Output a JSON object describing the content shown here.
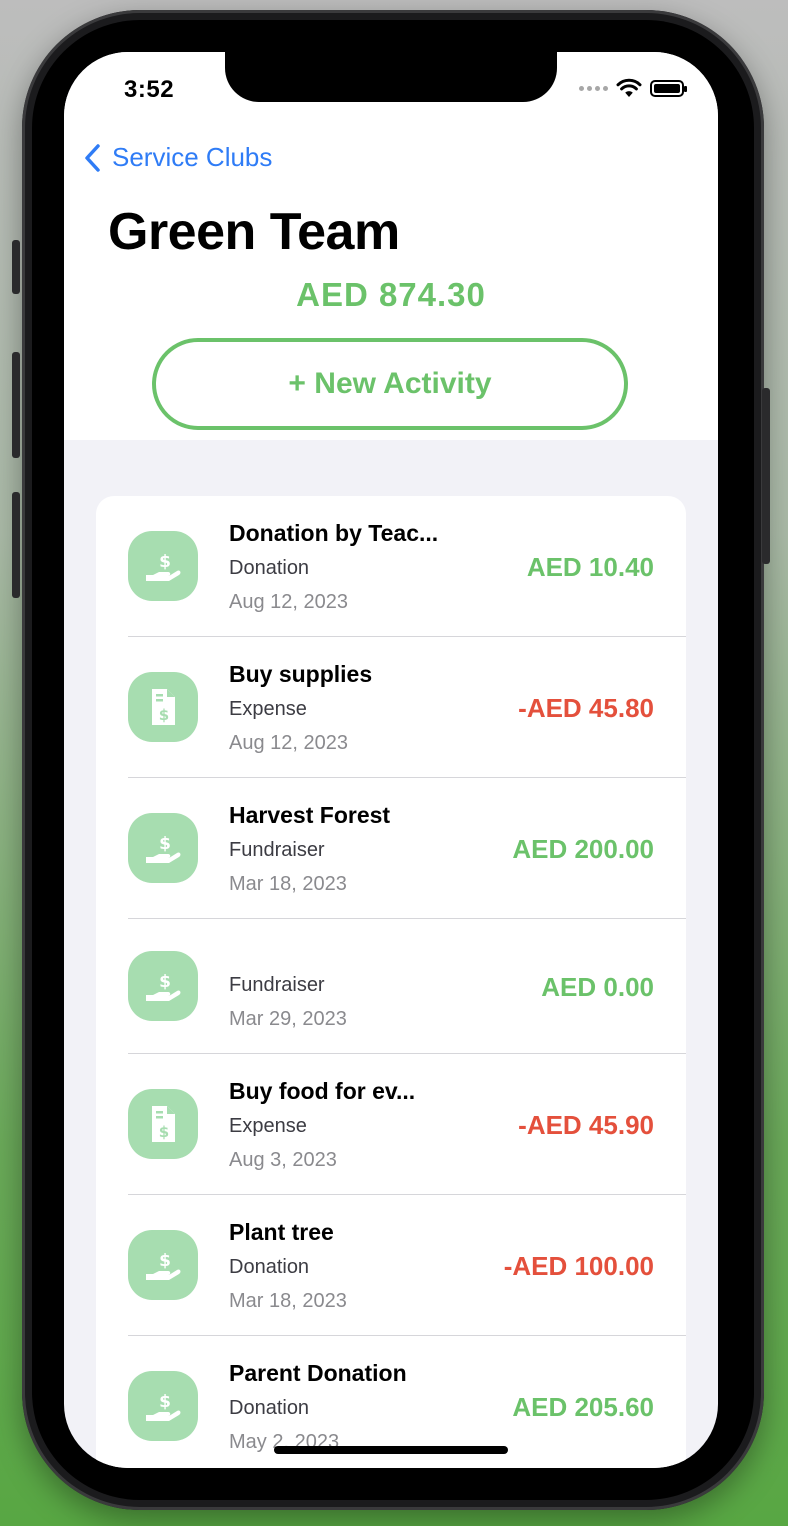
{
  "status_bar": {
    "time": "3:52"
  },
  "nav": {
    "back_label": "Service Clubs"
  },
  "header": {
    "title": "Green Team",
    "balance": "AED 874.30",
    "new_activity_label": "+ New Activity"
  },
  "colors": {
    "positive": "#6bc26a",
    "negative": "#e4503c",
    "icon_bg": "#a7ddb0",
    "link": "#2f7cf6"
  },
  "activities": [
    {
      "name": "Donation by Teac...",
      "type": "Donation",
      "date": "Aug 12, 2023",
      "amount": "AED 10.40",
      "icon": "hand-dollar-icon"
    },
    {
      "name": "Buy supplies",
      "type": "Expense",
      "date": "Aug 12, 2023",
      "amount": "-AED 45.80",
      "icon": "receipt-dollar-icon"
    },
    {
      "name": "Harvest Forest",
      "type": "Fundraiser",
      "date": "Mar 18, 2023",
      "amount": "AED 200.00",
      "icon": "hand-dollar-icon"
    },
    {
      "name": "",
      "type": "Fundraiser",
      "date": "Mar 29, 2023",
      "amount": "AED 0.00",
      "icon": "hand-dollar-icon"
    },
    {
      "name": "Buy food for ev...",
      "type": "Expense",
      "date": "Aug 3, 2023",
      "amount": "-AED 45.90",
      "icon": "receipt-dollar-icon"
    },
    {
      "name": "Plant tree",
      "type": "Donation",
      "date": "Mar 18, 2023",
      "amount": "-AED 100.00",
      "icon": "hand-dollar-icon"
    },
    {
      "name": "Parent Donation",
      "type": "Donation",
      "date": "May 2, 2023",
      "amount": "AED 205.60",
      "icon": "hand-dollar-icon"
    }
  ]
}
